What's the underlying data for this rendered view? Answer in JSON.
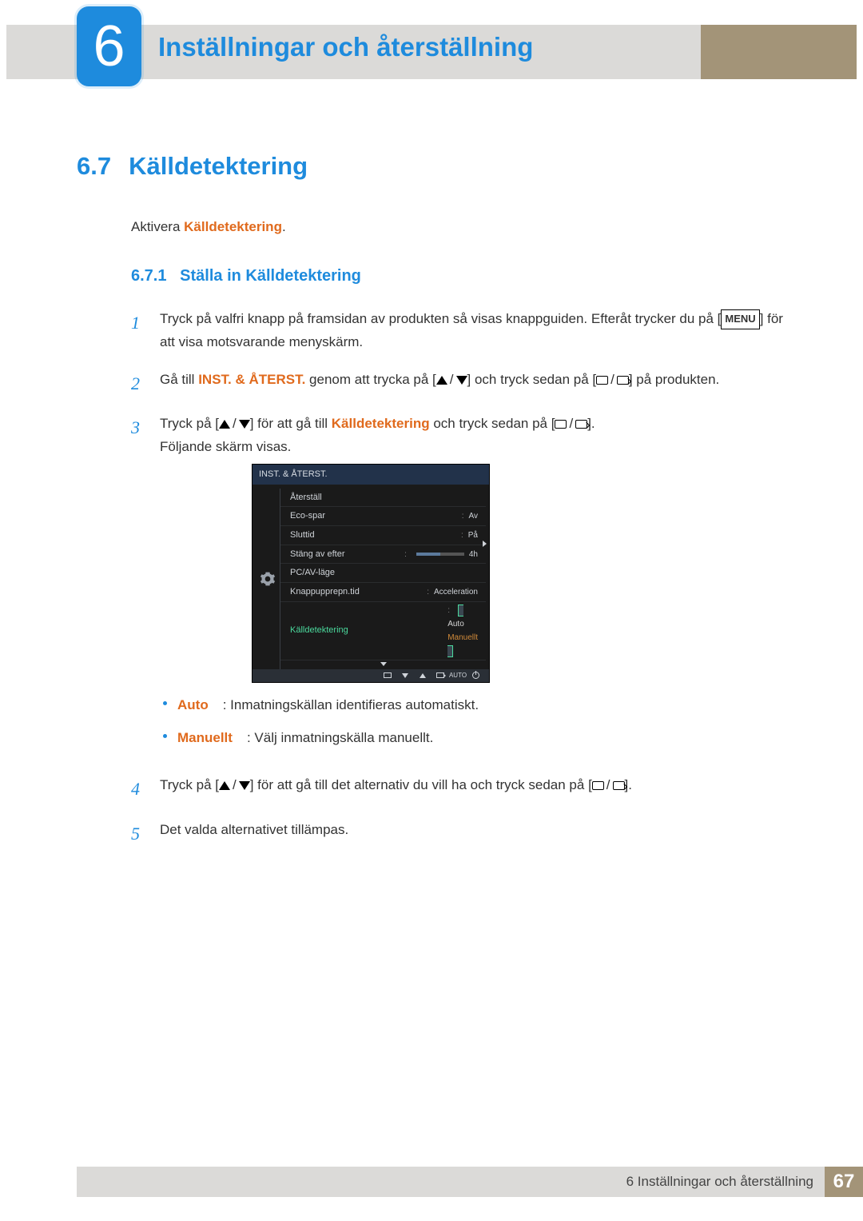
{
  "chapter": {
    "number": "6",
    "title": "Inställningar och återställning"
  },
  "section": {
    "number": "6.7",
    "title": "Källdetektering"
  },
  "intro": {
    "prefix": "Aktivera ",
    "term": "Källdetektering",
    "suffix": "."
  },
  "subsection": {
    "number": "6.7.1",
    "title": "Ställa in Källdetektering"
  },
  "steps": {
    "s1": {
      "a": "Tryck på valfri knapp på framsidan av produkten så visas knappguiden. Efteråt trycker du på [",
      "menu": "MENU",
      "b": "] för att visa motsvarande menyskärm."
    },
    "s2": {
      "a": "Gå till ",
      "term": "INST. & ÅTERST.",
      "b": " genom att trycka på [",
      "c": "] och tryck sedan på [",
      "d": "] på produkten."
    },
    "s3": {
      "a": "Tryck på [",
      "b": "] för att gå till ",
      "term": "Källdetektering",
      "c": " och tryck sedan på [",
      "d": "].",
      "trail": "Följande skärm visas."
    },
    "s4": {
      "a": "Tryck på [",
      "b": "] för att gå till det alternativ du vill ha och tryck sedan på [",
      "c": "]."
    },
    "s5": "Det valda alternativet tillämpas.",
    "bullets": {
      "auto_term": "Auto",
      "auto_text": ": Inmatningskällan identifieras automatiskt.",
      "man_term": "Manuellt",
      "man_text": ": Välj inmatningskälla manuellt."
    }
  },
  "osd": {
    "header": "INST. & ÅTERST.",
    "rows": {
      "r1": "Återställ",
      "r2": "Eco-spar",
      "r2v": "Av",
      "r3": "Sluttid",
      "r3v": "På",
      "r4": "Stäng av efter",
      "r4v": "4h",
      "r5": "PC/AV-läge",
      "r6": "Knappupprepn.tid",
      "r6v": "Acceleration",
      "r7": "Källdetektering",
      "drop1": "Auto",
      "drop2": "Manuellt"
    },
    "footer_auto": "AUTO"
  },
  "footer": {
    "label": "6 Inställningar och återställning",
    "page": "67"
  }
}
